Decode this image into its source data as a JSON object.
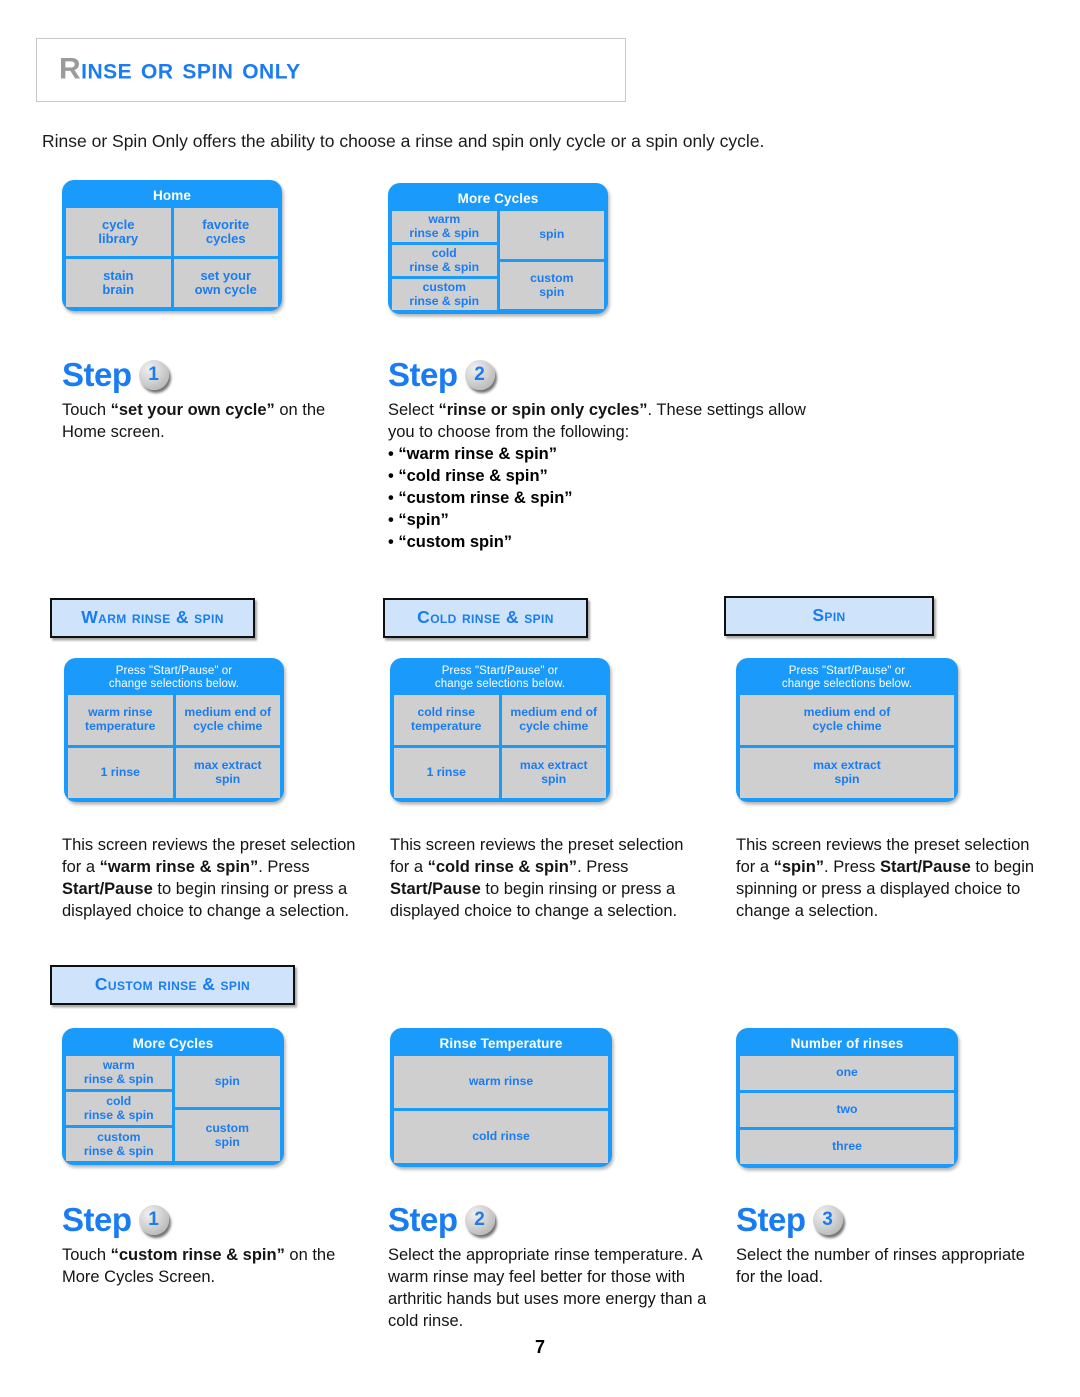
{
  "page": {
    "title_first_letter": "R",
    "title_rest": "inse or Spin Only",
    "number": "7",
    "intro": "Rinse or Spin Only offers the ability to choose a rinse and spin only cycle or a spin only cycle."
  },
  "screens": {
    "home": {
      "title": "Home",
      "cells": [
        "cycle\nlibrary",
        "favorite\ncycles",
        "stain\nbrain",
        "set your\nown cycle"
      ]
    },
    "more_cycles_top": {
      "title": "More Cycles",
      "left_cells": [
        "warm\nrinse & spin",
        "cold\nrinse & spin",
        "custom\nrinse & spin"
      ],
      "right_cells": [
        "spin",
        "custom\nspin"
      ]
    },
    "warm_rinse_spin": {
      "title": "Press \"Start/Pause\" or\nchange selections below.",
      "cells": [
        "warm rinse\ntemperature",
        "medium end of\ncycle chime",
        "1 rinse",
        "max extract\nspin"
      ]
    },
    "cold_rinse_spin": {
      "title": "Press \"Start/Pause\" or\nchange selections below.",
      "cells": [
        "cold rinse\ntemperature",
        "medium end of\ncycle chime",
        "1 rinse",
        "max extract\nspin"
      ]
    },
    "spin": {
      "title": "Press \"Start/Pause\" or\nchange selections below.",
      "cells": [
        "medium end of\ncycle chime",
        "max extract\nspin"
      ]
    },
    "more_cycles_bottom": {
      "title": "More Cycles",
      "left_cells": [
        "warm\nrinse & spin",
        "cold\nrinse & spin",
        "custom\nrinse & spin"
      ],
      "right_cells": [
        "spin",
        "custom\nspin"
      ]
    },
    "rinse_temperature": {
      "title": "Rinse Temperature",
      "cells": [
        "warm rinse",
        "cold rinse"
      ]
    },
    "number_of_rinses": {
      "title": "Number of rinses",
      "cells": [
        "one",
        "two",
        "three"
      ]
    }
  },
  "steps_top": {
    "step1": {
      "word": "Step",
      "number": "1",
      "text_before": "Touch ",
      "text_bold": "“set your own cycle”",
      "text_after": " on the Home screen."
    },
    "step2": {
      "word": "Step",
      "number": "2",
      "text_before": "Select ",
      "text_bold": "“rinse or spin only cycles”",
      "text_after": ". These settings allow you to choose from the following:",
      "bullets": [
        "• “warm rinse & spin”",
        "• “cold rinse & spin”",
        "• “custom rinse & spin”",
        "•  “spin”",
        "• “custom spin”"
      ]
    }
  },
  "sections": {
    "warm": {
      "cap": "W",
      "rest": "arm Rinse & Spin"
    },
    "cold": {
      "cap": "C",
      "rest": "old Rinse & Spin"
    },
    "spin": {
      "cap": "S",
      "rest": "pin"
    },
    "custom": {
      "cap": "C",
      "rest": "ustom Rinse & Spin"
    }
  },
  "descriptions": {
    "warm": {
      "p1": "This screen reviews the preset selection for a ",
      "b1": "“warm rinse & spin”",
      "p2": ". Press ",
      "b2": "Start/Pause",
      "p3": " to begin rinsing or press a displayed choice to change a selection."
    },
    "cold": {
      "p1": "This screen reviews the preset selection for a ",
      "b1": "“cold rinse & spin”",
      "p2": ". Press ",
      "b2": "Start/Pause",
      "p3": " to begin rinsing or press a displayed choice to change a selection."
    },
    "spin": {
      "p1": "This screen reviews the preset selection for a ",
      "b1": "“spin”",
      "p2": ".  Press ",
      "b2": "Start/Pause",
      "p3": " to begin spinning or press a displayed choice to change a selection."
    }
  },
  "steps_bottom": {
    "step1": {
      "word": "Step",
      "number": "1",
      "text_before": "Touch ",
      "text_bold": "“custom rinse & spin”",
      "text_after": " on the More Cycles Screen."
    },
    "step2": {
      "word": "Step",
      "number": "2",
      "text": "Select the appropriate rinse temperature. A warm rinse may feel better for those with arthritic hands but uses more energy than a cold rinse."
    },
    "step3": {
      "word": "Step",
      "number": "3",
      "text": "Select the number of rinses appropriate for the load."
    }
  }
}
